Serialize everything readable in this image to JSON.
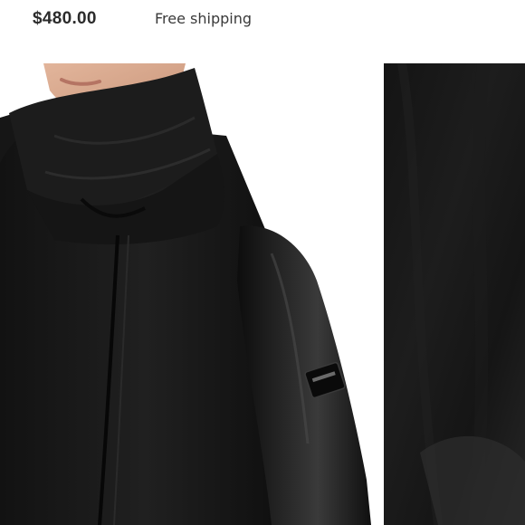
{
  "listing": {
    "price": "$480.00",
    "shipping": "Free shipping"
  },
  "images": {
    "main_photo": "black-puffer-coat-photo",
    "fabric_swatch": "black-fabric-closeup"
  },
  "colors": {
    "coat": "#1a1a1a",
    "skin": "#d8a78c",
    "background": "#ffffff"
  }
}
